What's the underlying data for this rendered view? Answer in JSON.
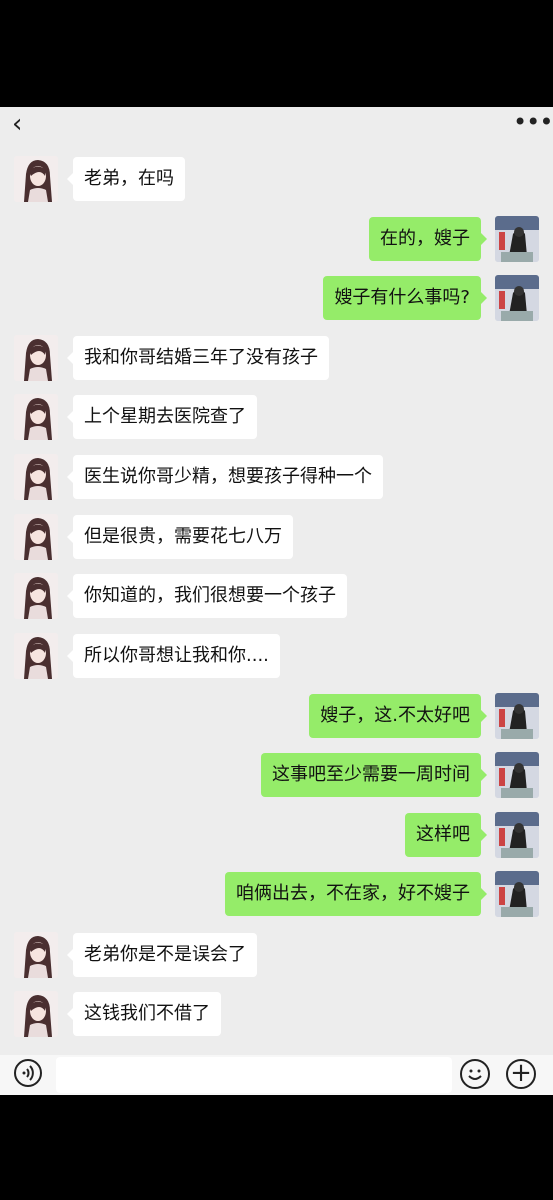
{
  "header": {
    "back_icon": "chevron-left-icon",
    "more_icon": "more-dots-icon",
    "more_glyph": "•••",
    "back_glyph": "‹"
  },
  "messages": [
    {
      "side": "left",
      "text": "老弟，在吗"
    },
    {
      "side": "right",
      "text": "在的，嫂子"
    },
    {
      "side": "right",
      "text": "嫂子有什么事吗?"
    },
    {
      "side": "left",
      "text": "我和你哥结婚三年了没有孩子"
    },
    {
      "side": "left",
      "text": "上个星期去医院查了"
    },
    {
      "side": "left",
      "text": "医生说你哥少精，想要孩子得种一个"
    },
    {
      "side": "left",
      "text": "但是很贵，需要花七八万"
    },
    {
      "side": "left",
      "text": "你知道的，我们很想要一个孩子"
    },
    {
      "side": "left",
      "text": "所以你哥想让我和你...."
    },
    {
      "side": "right",
      "text": "嫂子，这.不太好吧"
    },
    {
      "side": "right",
      "text": "这事吧至少需要一周时间"
    },
    {
      "side": "right",
      "text": "这样吧"
    },
    {
      "side": "right",
      "text": "咱俩出去，不在家，好不嫂子"
    },
    {
      "side": "left",
      "text": "老弟你是不是误会了"
    },
    {
      "side": "left",
      "text": "这钱我们不借了"
    }
  ],
  "colors": {
    "chat_bg": "#ededed",
    "left_bubble": "#ffffff",
    "right_bubble": "#95ec69"
  },
  "input_bar": {
    "voice_icon": "voice-icon",
    "emoji_icon": "emoji-icon",
    "plus_icon": "plus-icon",
    "plus_glyph": "+",
    "input_value": ""
  }
}
